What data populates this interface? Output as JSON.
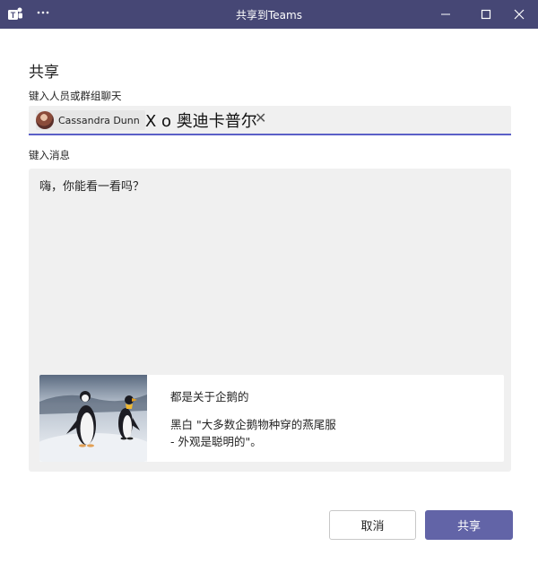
{
  "window": {
    "title": "共享到Teams",
    "app_icon": "teams-logo-icon",
    "more_icon": "ellipsis-icon",
    "controls": [
      "minimize-icon",
      "maximize-icon",
      "close-icon"
    ]
  },
  "heading": "共享",
  "people": {
    "label": "键入人员或群组聊天",
    "chip_name": "Cassandra Dunn",
    "typed_text": "X o 奥迪卡普尔",
    "clear_symbol": "✕"
  },
  "message": {
    "label": "键入消息",
    "text": "嗨，你能看一看吗？"
  },
  "card": {
    "title": "都是关于企鹅的",
    "description": "黑白 \"大多数企鹅物种穿的燕尾服\n- 外观是聪明的\"。"
  },
  "buttons": {
    "cancel": "取消",
    "share": "共享"
  },
  "colors": {
    "titlebar": "#464775",
    "accent": "#6264a7",
    "field_underline": "#5b5fc7",
    "field_bg": "#f0f0f0"
  }
}
